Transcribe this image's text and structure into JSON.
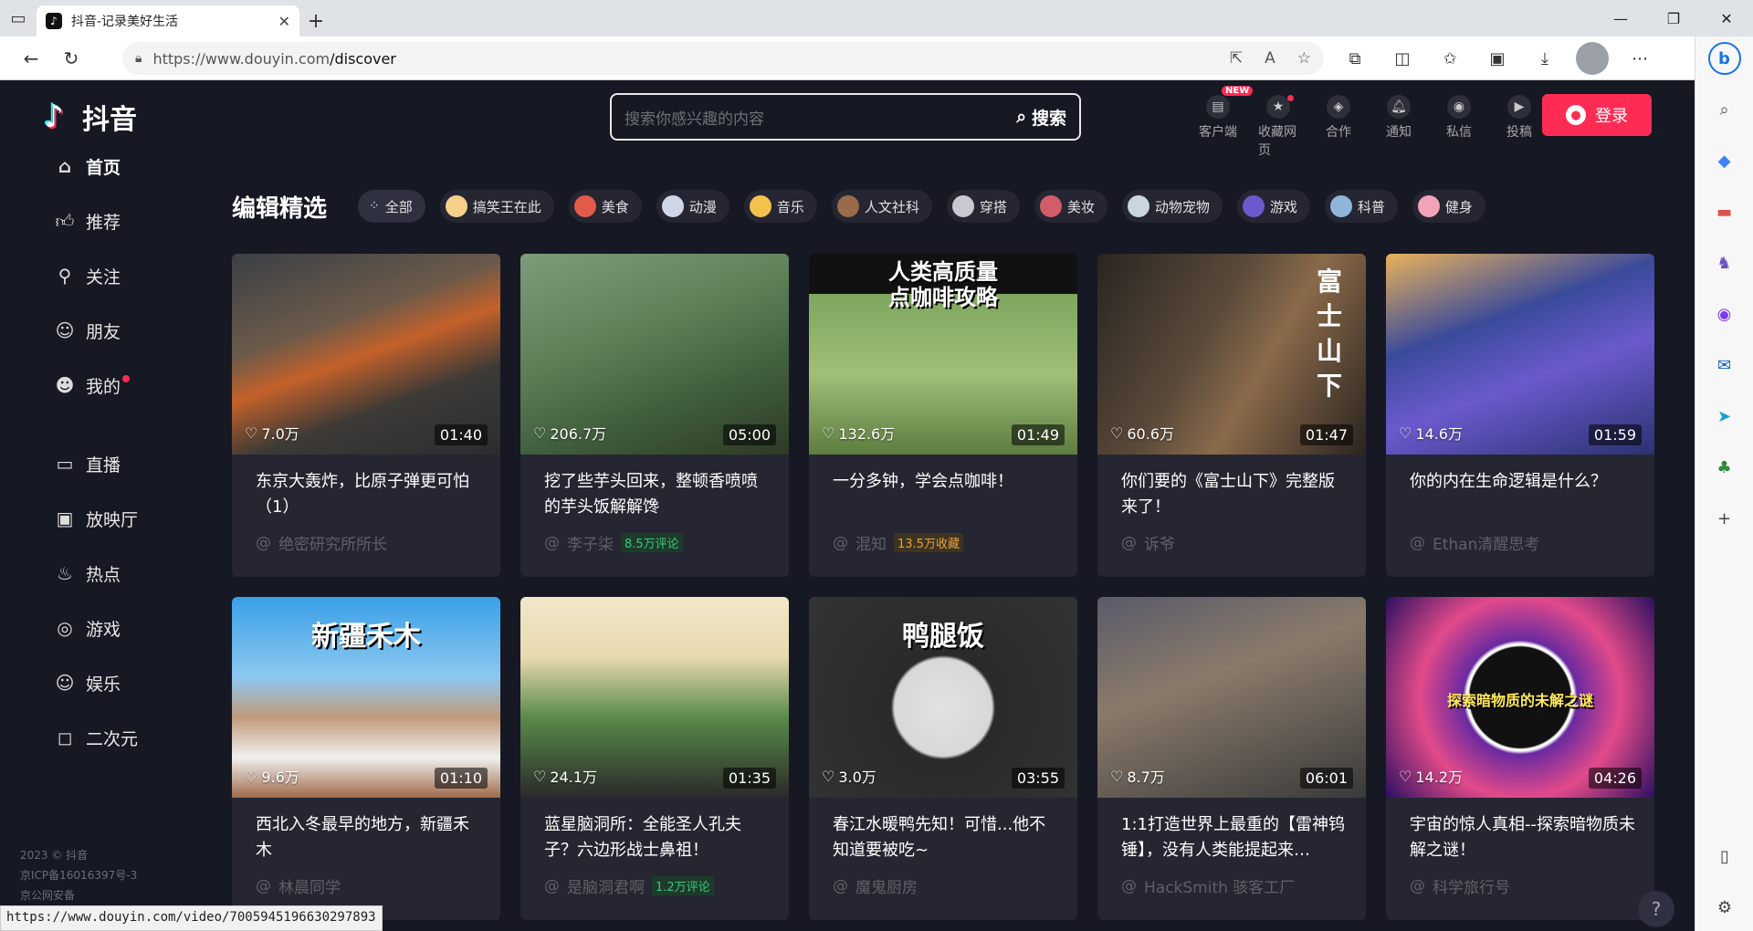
{
  "browser": {
    "tab_title": "抖音-记录美好生活",
    "url_host": "https://www.douyin.com",
    "url_path": "/discover",
    "status_url": "https://www.douyin.com/video/7005945196630297893"
  },
  "logo_text": "抖音",
  "nav": [
    {
      "icon": "home-icon",
      "label": "首页",
      "active": true
    },
    {
      "icon": "thumb-up-icon",
      "label": "推荐"
    },
    {
      "icon": "follow-icon",
      "label": "关注"
    },
    {
      "icon": "friends-icon",
      "label": "朋友"
    },
    {
      "icon": "user-icon",
      "label": "我的",
      "dot": true
    },
    {
      "icon": "live-icon",
      "label": "直播"
    },
    {
      "icon": "tv-icon",
      "label": "放映厅"
    },
    {
      "icon": "fire-icon",
      "label": "热点"
    },
    {
      "icon": "gamepad-icon",
      "label": "游戏"
    },
    {
      "icon": "smile-icon",
      "label": "娱乐"
    },
    {
      "icon": "anime-icon",
      "label": "二次元"
    }
  ],
  "footer": {
    "line1": "2023 © 抖音",
    "line2": "京ICP备16016397号-3",
    "line3": "京公网安备"
  },
  "search": {
    "placeholder": "搜索你感兴趣的内容",
    "button": "搜索"
  },
  "header_actions": [
    {
      "icon": "client-icon",
      "label": "客户端",
      "badge": "NEW"
    },
    {
      "icon": "star-icon",
      "label": "收藏网页",
      "dot": true
    },
    {
      "icon": "cooperate-icon",
      "label": "合作"
    },
    {
      "icon": "bell-icon",
      "label": "通知"
    },
    {
      "icon": "message-icon",
      "label": "私信"
    },
    {
      "icon": "upload-icon",
      "label": "投稿"
    }
  ],
  "login": "登录",
  "section_title": "编辑精选",
  "categories": [
    "全部",
    "搞笑王在此",
    "美食",
    "动漫",
    "音乐",
    "人文社科",
    "穿搭",
    "美妆",
    "动物宠物",
    "游戏",
    "科普",
    "健身"
  ],
  "videos": [
    {
      "title": "东京大轰炸，比原子弹更可怕（1）",
      "author": "绝密研究所所长",
      "likes": "7.0万",
      "duration": "01:40",
      "tag": "",
      "tag_style": "",
      "overlay": ""
    },
    {
      "title": "挖了些芋头回来，整顿香喷喷的芋头饭解解馋",
      "author": "李子柒",
      "likes": "206.7万",
      "duration": "05:00",
      "tag": "8.5万评论",
      "tag_style": "green",
      "overlay": ""
    },
    {
      "title": "一分多钟，学会点咖啡！",
      "author": "混知",
      "likes": "132.6万",
      "duration": "01:49",
      "tag": "13.5万收藏",
      "tag_style": "gold",
      "overlay": "人类高质量\n点咖啡攻略"
    },
    {
      "title": "你们要的《富士山下》完整版来了！",
      "author": "诉爷",
      "likes": "60.6万",
      "duration": "01:47",
      "tag": "",
      "tag_style": "",
      "overlay": "富\n士\n山\n下"
    },
    {
      "title": "你的内在生命逻辑是什么？",
      "author": "Ethan清醒思考",
      "likes": "14.6万",
      "duration": "01:59",
      "tag": "",
      "tag_style": "",
      "overlay": ""
    },
    {
      "title": "西北入冬最早的地方，新疆禾木",
      "author": "林晨同学",
      "likes": "9.6万",
      "duration": "01:10",
      "tag": "",
      "tag_style": "",
      "overlay": "新疆禾木"
    },
    {
      "title": "蓝星脑洞所：全能圣人孔夫子？六边形战士鼻祖！",
      "author": "是脑洞君啊",
      "likes": "24.1万",
      "duration": "01:35",
      "tag": "1.2万评论",
      "tag_style": "green",
      "overlay": ""
    },
    {
      "title": "春江水暖鸭先知！可惜...他不知道要被吃~",
      "author": "魔鬼厨房",
      "likes": "3.0万",
      "duration": "03:55",
      "tag": "",
      "tag_style": "",
      "overlay": "鸭腿饭"
    },
    {
      "title": "1:1打造世界上最重的【雷神钨锤】，没有人类能提起来…",
      "author": "HackSmith 骇客工厂",
      "likes": "8.7万",
      "duration": "06:01",
      "tag": "",
      "tag_style": "",
      "overlay": ""
    },
    {
      "title": "宇宙的惊人真相--探索暗物质未解之谜！",
      "author": "科学旅行号",
      "likes": "14.2万",
      "duration": "04:26",
      "tag": "",
      "tag_style": "",
      "overlay": "探索暗物质的未解之谜"
    }
  ]
}
